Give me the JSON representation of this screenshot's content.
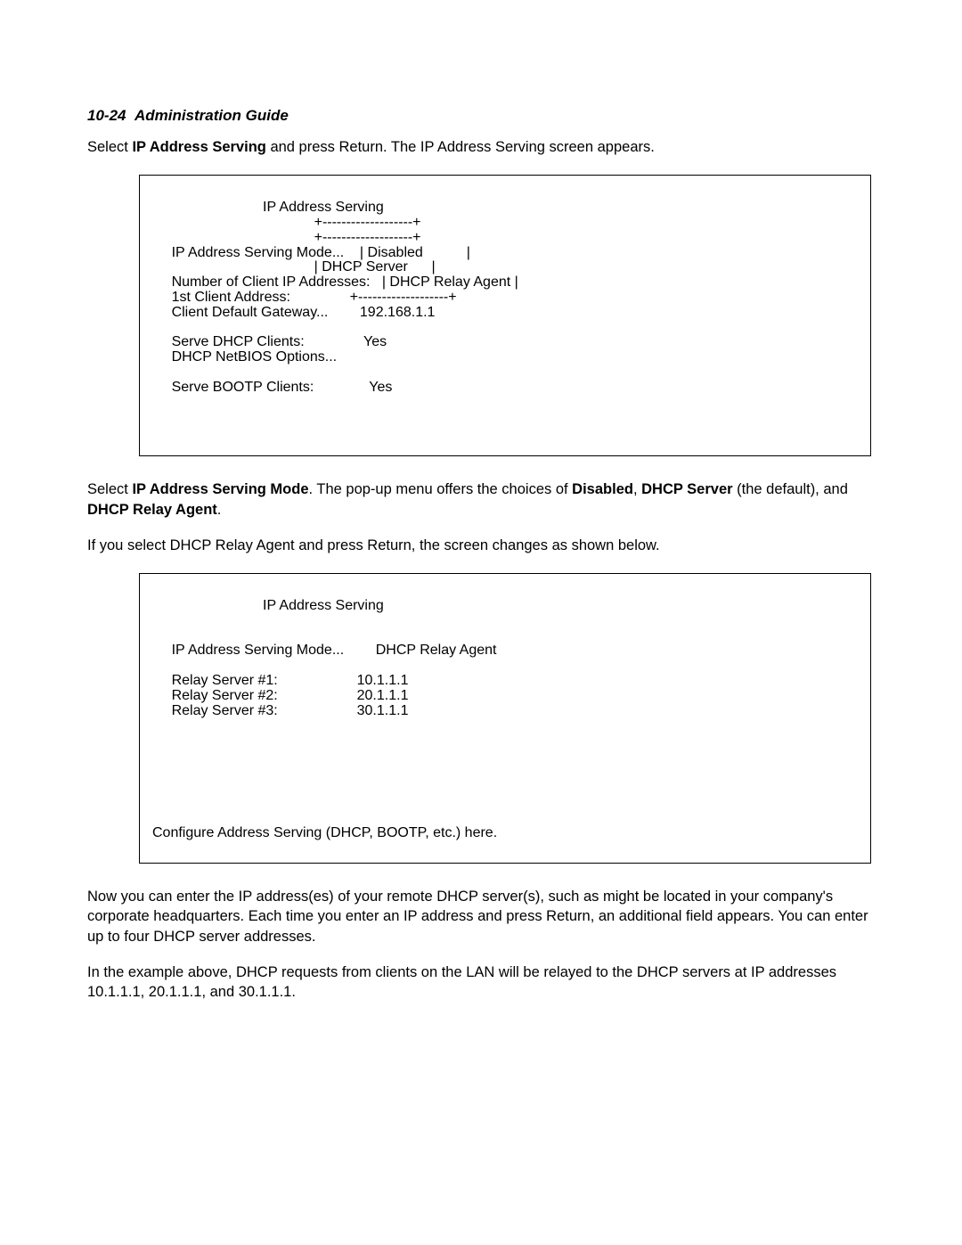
{
  "header": {
    "page_num": "10-24",
    "title": "Administration Guide"
  },
  "intro_para": {
    "before": "Select ",
    "bold": "IP Address Serving",
    "after": " and press Return. The IP Address Serving screen appears."
  },
  "screen1": {
    "title": "IP Address Serving",
    "line_border1": "                                            +-------------------+",
    "line_border2": "                                            +-------------------+",
    "line_mode": "        IP Address Serving Mode...    | Disabled           |",
    "line_dhcp": "                                            | DHCP Server      |",
    "line_num": "        Number of Client IP Addresses:   | DHCP Relay Agent |",
    "line_1st": "        1st Client Address:               +-------------------+",
    "line_gw": "        Client Default Gateway...        192.168.1.1",
    "line_serve_dhcp": "        Serve DHCP Clients:               Yes",
    "line_netbios": "        DHCP NetBIOS Options...",
    "line_bootp": "        Serve BOOTP Clients:              Yes"
  },
  "mid_para": {
    "p1_before": "Select ",
    "p1_bold1": "IP Address Serving Mode",
    "p1_mid": ". The pop-up menu offers the choices of ",
    "p1_bold2": "Disabled",
    "p1_mid2": ", ",
    "p1_bold3": "DHCP Server",
    "p1_mid3": " (the default), and ",
    "p1_bold4": "DHCP Relay Agent",
    "p1_end": "."
  },
  "mid_para2": "If you select DHCP Relay Agent and press Return, the screen changes as shown below.",
  "screen2": {
    "title": "IP Address Serving",
    "line_mode": "        IP Address Serving Mode...        DHCP Relay Agent",
    "line_r1": "        Relay Server #1:                    10.1.1.1",
    "line_r2": "        Relay Server #2:                    20.1.1.1",
    "line_r3": "        Relay Server #3:                    30.1.1.1",
    "footer": "Configure Address Serving (DHCP, BOOTP, etc.) here."
  },
  "after_para1": "Now you can enter the IP address(es) of your remote DHCP server(s), such as might be located in your company's corporate headquarters. Each time you enter an IP address and press Return, an additional field appears. You can enter up to four DHCP server addresses.",
  "after_para2": "In the example above, DHCP requests from clients on the LAN will be relayed to the DHCP servers at IP addresses 10.1.1.1, 20.1.1.1, and 30.1.1.1."
}
